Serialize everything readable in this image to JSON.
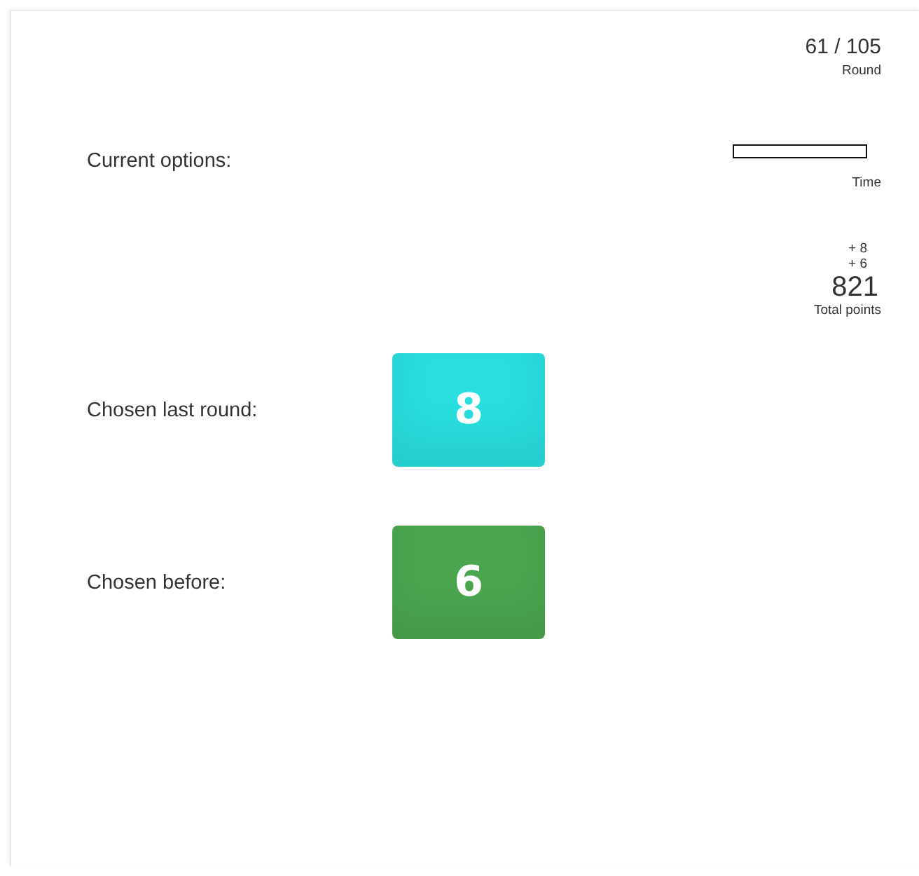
{
  "round": {
    "value": "61 / 105",
    "label": "Round"
  },
  "timer": {
    "level": 0,
    "label": "Time"
  },
  "points": {
    "gains": [
      "+ 8",
      "+ 6"
    ],
    "total": "821",
    "label": "Total points"
  },
  "current_options": {
    "label": "Current options:"
  },
  "history": [
    {
      "label": "Chosen last round:",
      "value": "8",
      "color": "#29dede"
    },
    {
      "label": "Chosen before:",
      "value": "6",
      "color": "#4ba64f"
    }
  ]
}
